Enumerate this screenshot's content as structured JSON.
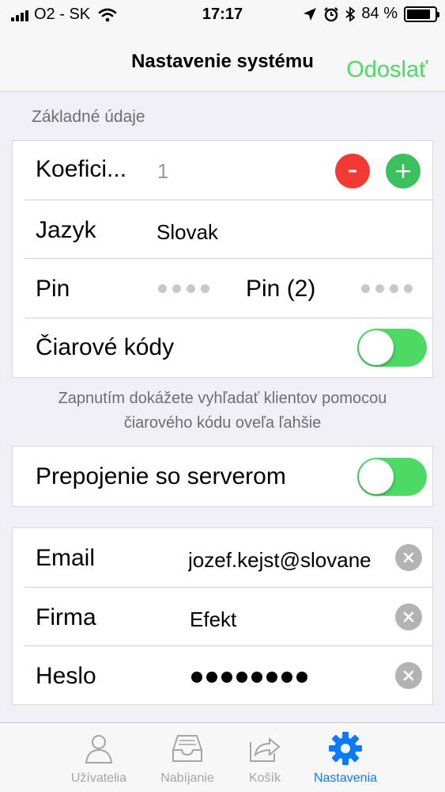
{
  "status_bar": {
    "carrier": "O2 - SK",
    "time": "17:17",
    "battery_percent": "84 %",
    "battery_level": 0.84
  },
  "nav": {
    "title": "Nastavenie systému",
    "action": "Odoslať"
  },
  "section_basic": {
    "header": "Základné údaje",
    "koeficient": {
      "label": "Koefici...",
      "value": "1",
      "minus_icon": "minus-icon",
      "plus_icon": "plus-icon"
    },
    "jazyk": {
      "label": "Jazyk",
      "value": "Slovak"
    },
    "pin": {
      "label": "Pin",
      "label2": "Pin (2)"
    },
    "barcodes": {
      "label": "Čiarové kódy",
      "enabled": true
    },
    "footer": [
      "Zapnutím dokážete vyhľadať klientov pomocou",
      "čiarového kódu oveľa ľahšie"
    ]
  },
  "section_server": {
    "label": "Prepojenie so serverom",
    "enabled": true
  },
  "section_account": {
    "email": {
      "label": "Email",
      "value": "jozef.kejst@slovane"
    },
    "firma": {
      "label": "Firma",
      "value": "Efekt"
    },
    "heslo": {
      "label": "Heslo",
      "dots": 8
    }
  },
  "tabs": [
    {
      "label": "Užívatelia",
      "icon": "user-icon",
      "active": false
    },
    {
      "label": "Nabíjanie",
      "icon": "inbox-icon",
      "active": false
    },
    {
      "label": "Košík",
      "icon": "share-icon",
      "active": false
    },
    {
      "label": "Nastavenia",
      "icon": "gear-icon",
      "active": true
    }
  ],
  "colors": {
    "accent_green": "#4cd964",
    "tab_active": "#0a7aff",
    "minus_red": "#f23a33",
    "plus_green": "#3ac05c"
  }
}
